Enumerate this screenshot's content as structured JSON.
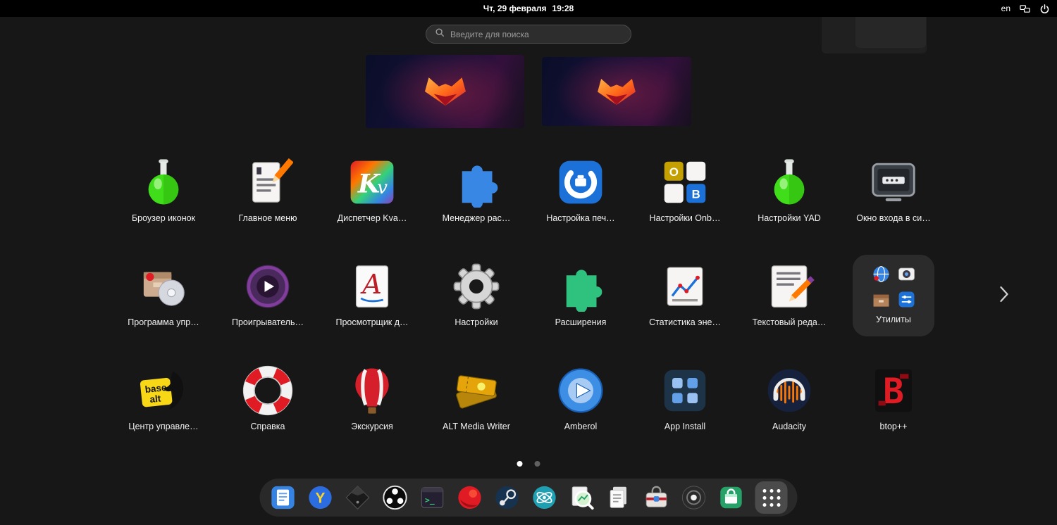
{
  "topbar": {
    "clock_date": "Чт, 29 февраля",
    "clock_time": "19:28",
    "keyboard_layout": "en",
    "status_icons": [
      "network-workgroup-icon",
      "power-icon"
    ]
  },
  "search": {
    "placeholder": "Введите для поиска",
    "icon": "search-icon"
  },
  "workspaces": {
    "count": 2,
    "active_index": 0,
    "wallpaper_motif": "dark-fox-logo"
  },
  "app_grid": {
    "page_indicator": {
      "count": 2,
      "active": 0
    },
    "next_arrow": "chevron-right-icon",
    "apps": [
      {
        "label": "Броузер иконок",
        "icon": "flask-green"
      },
      {
        "label": "Главное меню",
        "icon": "notes-pencil"
      },
      {
        "label": "Диспетчер Kva…",
        "icon": "kv-colorful"
      },
      {
        "label": "Менеджер рас…",
        "icon": "puzzle-blue"
      },
      {
        "label": "Настройка печ…",
        "icon": "printer-config-blue"
      },
      {
        "label": "Настройки Onb…",
        "icon": "onboard-keys"
      },
      {
        "label": "Настройки YAD",
        "icon": "flask-green"
      },
      {
        "label": "Окно входа в си…",
        "icon": "login-screen"
      },
      {
        "label": "Программа упр…",
        "icon": "package-cd"
      },
      {
        "label": "Проигрыватель…",
        "icon": "media-player-purple"
      },
      {
        "label": "Просмотрщик д…",
        "icon": "document-viewer-a"
      },
      {
        "label": "Настройки",
        "icon": "gear"
      },
      {
        "label": "Расширения",
        "icon": "puzzle-green"
      },
      {
        "label": "Статистика эне…",
        "icon": "chart-document"
      },
      {
        "label": "Текстовый реда…",
        "icon": "text-editor-pencil"
      },
      {
        "label": "Утилиты",
        "icon": "app-folder",
        "type": "folder",
        "mini_icons": [
          "globe",
          "screenshot",
          "archive-box",
          "tweaks"
        ]
      },
      {
        "label": "Центр управле…",
        "icon": "basealt-logo"
      },
      {
        "label": "Справка",
        "icon": "lifebuoy"
      },
      {
        "label": "Экскурсия",
        "icon": "hot-air-balloon"
      },
      {
        "label": "ALT Media Writer",
        "icon": "media-writer-tickets"
      },
      {
        "label": "Amberol",
        "icon": "amberol-play"
      },
      {
        "label": "App Install",
        "icon": "app-install-grid"
      },
      {
        "label": "Audacity",
        "icon": "audacity-headphones"
      },
      {
        "label": "btop++",
        "icon": "btop-red-b"
      }
    ]
  },
  "dock": {
    "items": [
      "files",
      "y-browser",
      "inkscape",
      "obs-studio",
      "terminal",
      "red-browser",
      "steam",
      "atom-teal",
      "log-viewer",
      "documents",
      "toolbox",
      "recorder",
      "software-center",
      "show-apps"
    ]
  }
}
